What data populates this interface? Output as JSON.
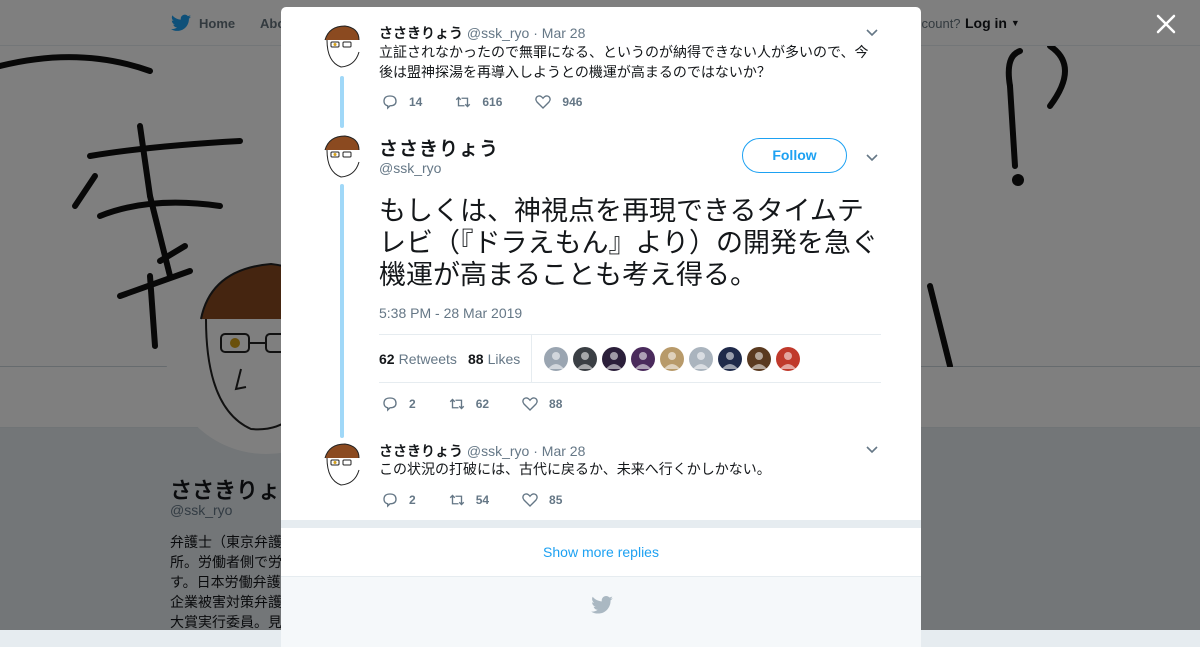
{
  "topbar": {
    "home_label": "Home",
    "about_label": "Abo",
    "account_prompt": "ccount?",
    "login_label": "Log in"
  },
  "background_profile": {
    "name": "ささきりょ",
    "handle": "@ssk_ryo",
    "bio_lines": [
      "弁護士（東京弁護",
      "所。労働者側で労",
      "す。日本労働弁護",
      "企業被害対策弁護",
      "大賞実行委員。見"
    ]
  },
  "thread": {
    "prev_tweet": {
      "name": "ささきりょう",
      "handle": "@ssk_ryo",
      "date": "· Mar 28",
      "text": "立証されなかったので無罪になる、というのが納得できない人が多いので、今後は盟神探湯を再導入しようとの機運が高まるのではないか？",
      "replies": "14",
      "retweets": "616",
      "likes": "946"
    },
    "main_tweet": {
      "name": "ささきりょう",
      "handle": "@ssk_ryo",
      "follow_label": "Follow",
      "text": "もしくは、神視点を再現できるタイムテレビ（『ドラえもん』より）の開発を急ぐ機運が高まることも考え得る。",
      "timestamp": "5:38 PM - 28 Mar 2019",
      "retweet_count": "62",
      "retweet_label": "Retweets",
      "like_count": "88",
      "like_label": "Likes",
      "liker_colors": [
        "#9aa5b1",
        "#3a3f44",
        "#2b1f3a",
        "#4a2a5c",
        "#b89a6a",
        "#aab4be",
        "#1f2a4a",
        "#5a3a20",
        "#c0392b"
      ],
      "replies": "2",
      "retweets": "62",
      "likes": "88"
    },
    "next_tweet": {
      "name": "ささきりょう",
      "handle": "@ssk_ryo",
      "date": "· Mar 28",
      "text": "この状況の打破には、古代に戻るか、未来へ行くかしかない。",
      "replies": "2",
      "retweets": "54",
      "likes": "85"
    }
  },
  "show_more_label": "Show more replies",
  "colors": {
    "brand": "#1da1f2",
    "thread_line": "#a0d8f8",
    "muted": "#657786"
  }
}
